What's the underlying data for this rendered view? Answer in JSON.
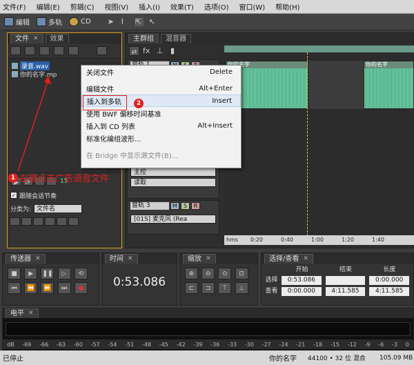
{
  "menu": [
    "文件(F)",
    "编辑(E)",
    "剪辑(C)",
    "视图(V)",
    "插入(I)",
    "效果(T)",
    "选项(O)",
    "窗口(W)",
    "帮助(H)"
  ],
  "toolbar": {
    "edit": "编辑",
    "multitrack": "多轨",
    "cd": "CD"
  },
  "files_panel": {
    "tab_files": "文件",
    "tab_effects": "效果",
    "items": [
      "录音.wav",
      "你的名字.mp"
    ],
    "play_count": "15",
    "follow_label": "跟随会话节奏",
    "sort_label": "分类为:",
    "sort_value": "文件名"
  },
  "annotation1": {
    "num": "1",
    "text": "右键点击广告语音文件"
  },
  "annotation2": {
    "num": "2"
  },
  "context_menu": [
    {
      "label": "关闭文件",
      "shortcut": "Delete"
    },
    {
      "label": "编辑文件",
      "shortcut": "Alt+Enter"
    },
    {
      "label": "插入到多轨",
      "shortcut": "Insert"
    },
    {
      "label": "使用 BWF 偏移时间基准",
      "shortcut": ""
    },
    {
      "label": "插入到 CD 列表",
      "shortcut": "Alt+Insert"
    },
    {
      "label": "标准化编组波形...",
      "shortcut": ""
    },
    {
      "label": "在 Bridge 中显示源文件(B)...",
      "shortcut": ""
    }
  ],
  "multitrack": {
    "tab_main": "主群组",
    "tab_mixer": "混音器",
    "track1": "音轨 1",
    "clip1": "你的名字",
    "clip2": "你的名字",
    "master": "主控",
    "read": "读取",
    "track3": "音轨 3",
    "input": "[01S] 麦克风 (Rea",
    "ruler": [
      "hms",
      "0:20",
      "0:40",
      "1:00",
      "1:20",
      "1:40"
    ]
  },
  "transport": {
    "title": "传送器"
  },
  "time": {
    "title": "时间",
    "value": "0:53.086"
  },
  "zoom": {
    "title": "缩放"
  },
  "selview": {
    "title": "选择/查看",
    "col_start": "开始",
    "col_end": "结束",
    "col_len": "长度",
    "row_sel": "选择",
    "row_view": "查看",
    "sel_start": "0:53.086",
    "sel_end": "",
    "sel_len": "0:00.000",
    "view_start": "0:00.000",
    "view_end": "4:11.585",
    "view_len": "4:11.585"
  },
  "level": {
    "title": "电平",
    "scale": [
      "dB",
      "-69",
      "-66",
      "-63",
      "-60",
      "-57",
      "-54",
      "-51",
      "-48",
      "-45",
      "-42",
      "-39",
      "-36",
      "-33",
      "-30",
      "-27",
      "-24",
      "-21",
      "-18",
      "-15",
      "-12",
      "-9",
      "-6",
      "-3",
      "0"
    ]
  },
  "status": {
    "left": "已停止",
    "session": "你的名字",
    "format": "44100 • 32 位 混合",
    "size": "105.09 MB"
  }
}
